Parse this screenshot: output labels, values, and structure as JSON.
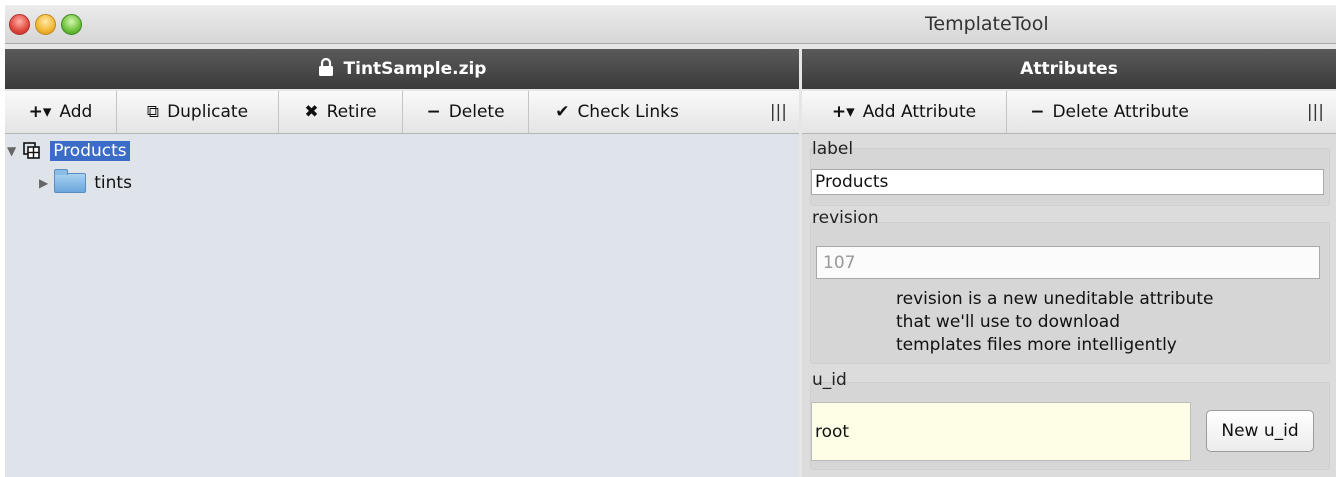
{
  "window": {
    "title": "TemplateTool"
  },
  "left_panel": {
    "header": "TintSample.zip",
    "toolbar": [
      {
        "icon": "plus-dropdown-icon",
        "glyph": "+▾",
        "label": "Add"
      },
      {
        "icon": "duplicate-icon",
        "glyph": "⧉",
        "label": "Duplicate"
      },
      {
        "icon": "retire-icon",
        "glyph": "✖",
        "label": "Retire"
      },
      {
        "icon": "minus-icon",
        "glyph": "−",
        "label": "Delete"
      },
      {
        "icon": "checkmark-icon",
        "glyph": "✔",
        "label": "Check Links"
      }
    ],
    "tree": [
      {
        "label": "Products",
        "expanded": true,
        "selected": true,
        "icon": "template-icon"
      },
      {
        "label": "tints",
        "expanded": false,
        "selected": false,
        "icon": "folder-icon"
      }
    ]
  },
  "right_panel": {
    "header": "Attributes",
    "toolbar": [
      {
        "icon": "plus-dropdown-icon",
        "glyph": "+▾",
        "label": "Add Attribute"
      },
      {
        "icon": "minus-icon",
        "glyph": "−",
        "label": "Delete Attribute"
      }
    ],
    "label_group": {
      "title": "label",
      "value": "Products"
    },
    "revision_group": {
      "title": "revision",
      "value": "107",
      "note_lines": [
        "revision is a new uneditable attribute",
        "that we'll use to download",
        "templates files more intelligently"
      ]
    },
    "uid_group": {
      "title": "u_id",
      "value": "root",
      "button": "New u_id"
    }
  },
  "grip": "|||"
}
